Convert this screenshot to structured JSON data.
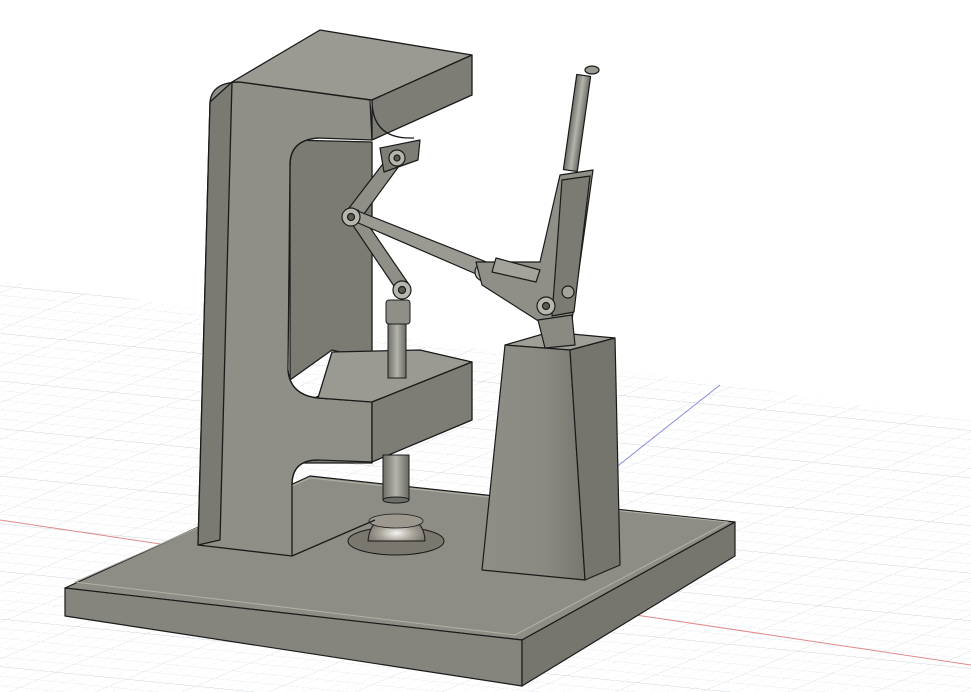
{
  "viewport": {
    "background": "#ffffff",
    "grid": {
      "visible": true,
      "minor_color": "#dfe4ea",
      "major_color": "#c7ced8",
      "x_axis_color": "#e08a8a",
      "y_axis_color": "#8a8ae0"
    }
  },
  "model": {
    "body_color": "#8c8c84",
    "body_light": "#a3a39b",
    "body_dark": "#6f6f68",
    "edge_color": "#1a1a1a",
    "parts": [
      "base-plate",
      "c-frame",
      "pedestal",
      "linkage-arms",
      "hand-lever",
      "ram-shaft",
      "anvil-dome"
    ]
  }
}
